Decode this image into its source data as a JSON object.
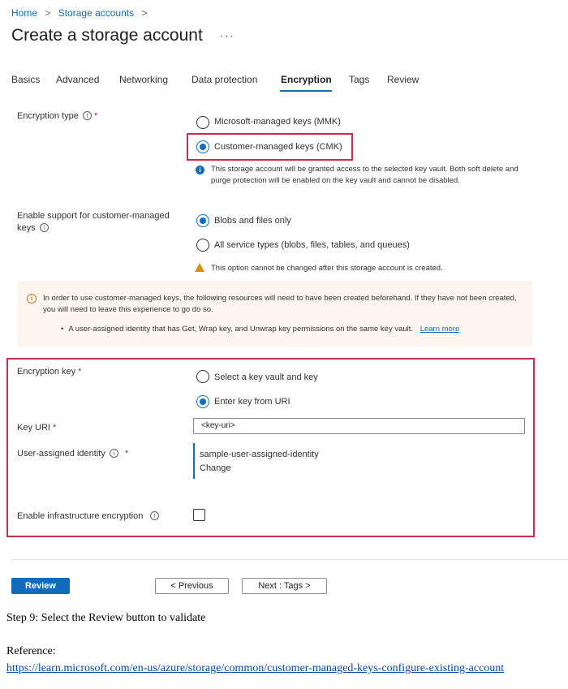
{
  "breadcrumb": {
    "home": "Home",
    "storage_accounts": "Storage accounts",
    "sep": ">"
  },
  "page": {
    "title": "Create a storage account",
    "more": "···"
  },
  "tabs": [
    {
      "label": "Basics"
    },
    {
      "label": "Advanced"
    },
    {
      "label": "Networking"
    },
    {
      "label": "Data protection"
    },
    {
      "label": "Encryption",
      "active": true
    },
    {
      "label": "Tags"
    },
    {
      "label": "Review"
    }
  ],
  "encryption_type": {
    "label": "Encryption type",
    "required": "*",
    "options": [
      {
        "label": "Microsoft-managed keys (MMK)",
        "checked": false
      },
      {
        "label": "Customer-managed keys (CMK)",
        "checked": true
      }
    ],
    "info_note": "This storage account will be granted access to the selected key vault. Both soft delete and purge protection will be enabled on the key vault and cannot be disabled."
  },
  "cmk_support": {
    "label": "Enable support for customer-managed keys",
    "options": [
      {
        "label": "Blobs and files only",
        "checked": true
      },
      {
        "label": "All service types (blobs, files, tables, and queues)",
        "checked": false
      }
    ],
    "warning": "This option cannot be changed after this storage account is created."
  },
  "banner": {
    "text": "In order to use customer-managed keys, the following resources will need to have been created beforehand. If they have not been created, you will need to leave this experience to go do so.",
    "bullet": "A user-assigned identity that has Get, Wrap key, and Unwrap key permissions on the same key vault.",
    "learn_more": "Learn more"
  },
  "encryption_key": {
    "label": "Encryption key",
    "required": "*",
    "options": [
      {
        "label": "Select a key vault and key",
        "checked": false
      },
      {
        "label": "Enter key from URI",
        "checked": true
      }
    ]
  },
  "key_uri": {
    "label": "Key URI",
    "required": "*",
    "value": "<key-uri>"
  },
  "identity": {
    "label": "User-assigned identity",
    "required": "*",
    "value": "sample-user-assigned-identity",
    "change": "Change"
  },
  "infra": {
    "label": "Enable infrastructure encryption",
    "checked": false
  },
  "footer": {
    "review": "Review",
    "previous": "< Previous",
    "next": "Next : Tags >"
  },
  "doc": {
    "step": "Step 9: Select the Review button to validate",
    "reference_label": "Reference:",
    "reference_url": "https://learn.microsoft.com/en-us/azure/storage/common/customer-managed-keys-configure-existing-account"
  },
  "colors": {
    "accent": "#0f6cbd",
    "highlight_border": "#c4314b",
    "banner_bg": "#fdf6ee",
    "warning": "#d29200"
  }
}
